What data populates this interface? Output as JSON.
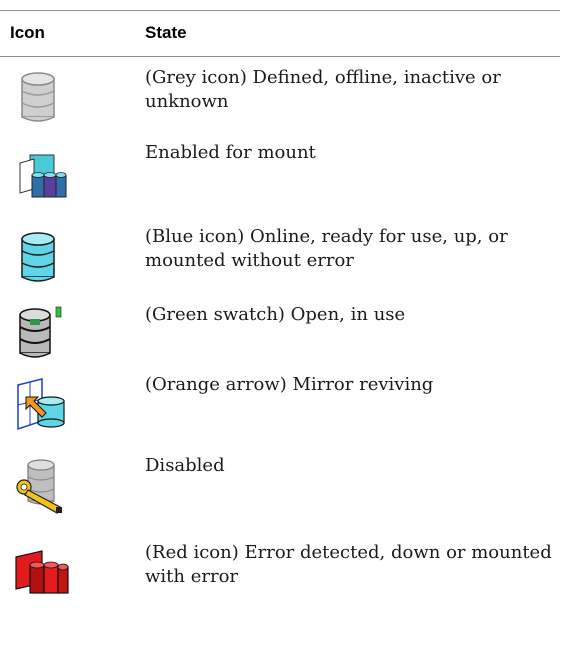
{
  "header": {
    "col_icon": "Icon",
    "col_state": "State"
  },
  "rows": [
    {
      "icon": "grey-disk-icon",
      "state": "(Grey icon) Defined, offline, inactive or unknown"
    },
    {
      "icon": "enabled-mount-icon",
      "state": "Enabled for mount"
    },
    {
      "icon": "blue-disk-icon",
      "state": "(Blue icon) Online, ready for use, up, or mounted without error"
    },
    {
      "icon": "green-swatch-disk-icon",
      "state": "(Green swatch) Open, in use"
    },
    {
      "icon": "orange-arrow-mirror-icon",
      "state": "(Orange arrow) Mirror reviving"
    },
    {
      "icon": "disabled-wrench-icon",
      "state": "Disabled"
    },
    {
      "icon": "red-error-icon",
      "state": "(Red icon) Error detected, down or mounted with error"
    }
  ],
  "colors": {
    "grey": "#c8c8c8",
    "blue": "#5fd6e8",
    "green": "#3fb43f",
    "orange": "#f39a1e",
    "red": "#e21c1c",
    "rule": "#8c8c8c"
  }
}
